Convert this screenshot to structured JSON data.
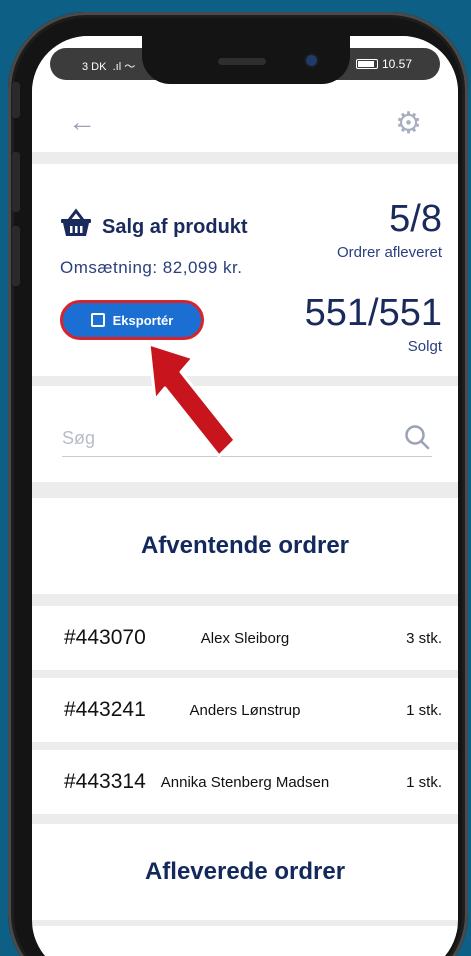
{
  "status_bar": {
    "carrier": "3 DK",
    "time": "10.57"
  },
  "header": {
    "back_icon": "arrow-left-icon",
    "settings_icon": "gear-icon"
  },
  "summary": {
    "title": "Salg af produkt",
    "revenue": "Omsætning: 82,099 kr.",
    "export_label": "Eksportér",
    "orders_delivered_value": "5/8",
    "orders_delivered_label": "Ordrer afleveret",
    "sold_value": "551/551",
    "sold_label": "Solgt"
  },
  "search": {
    "placeholder": "Søg"
  },
  "pending": {
    "title": "Afventende ordrer",
    "orders": [
      {
        "id": "#443070",
        "name": "Alex Sleiborg",
        "qty": "3 stk."
      },
      {
        "id": "#443241",
        "name": "Anders Lønstrup",
        "qty": "1 stk."
      },
      {
        "id": "#443314",
        "name": "Annika Stenberg Madsen",
        "qty": "1 stk."
      }
    ]
  },
  "delivered": {
    "title": "Afleverede ordrer"
  },
  "colors": {
    "accent": "#1b6fd3",
    "brand_navy": "#13285c",
    "highlight": "#d8232a",
    "background": "#0d5f85"
  }
}
